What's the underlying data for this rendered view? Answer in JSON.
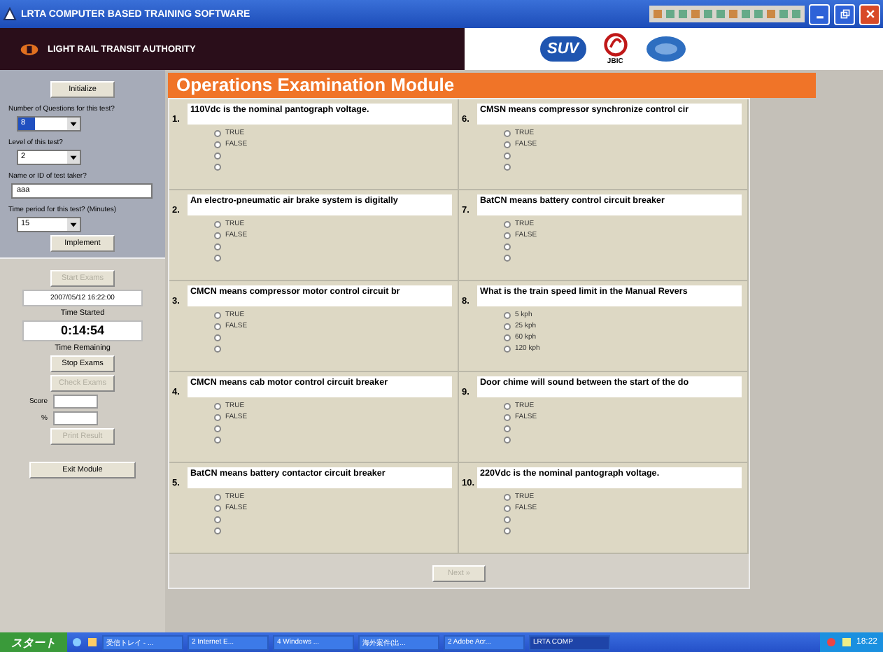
{
  "window": {
    "title": "LRTA COMPUTER BASED TRAINING SOFTWARE"
  },
  "header": {
    "organization": "LIGHT RAIL TRANSIT AUTHORITY",
    "logos": [
      "SUV",
      "JBIC"
    ]
  },
  "sidebar": {
    "initialize": {
      "label": "Initialize",
      "disabled": false
    },
    "fields": [
      {
        "kind": "dropdown",
        "label": "Number of Questions for this test?",
        "value": "8",
        "highlighted": true
      },
      {
        "kind": "dropdown",
        "label": "Level of this test?",
        "value": "2",
        "highlighted": false
      },
      {
        "kind": "text",
        "label": "Name or ID of test taker?",
        "value": "aaa",
        "highlighted": false
      },
      {
        "kind": "dropdown",
        "label": "Time period for this test? (Minutes)",
        "value": "15",
        "highlighted": false
      }
    ],
    "implement": {
      "label": "Implement",
      "disabled": false
    },
    "start": {
      "label": "Start Exams",
      "disabled": true
    },
    "time_started": {
      "value": "2007/05/12 16:22:00",
      "label": "Time Started"
    },
    "time_remaining": {
      "value": "0:14:54",
      "label": "Time Remaining"
    },
    "stop": {
      "label": "Stop Exams",
      "disabled": false
    },
    "check": {
      "label": "Check Exams",
      "disabled": true
    },
    "score": {
      "label": "Score"
    },
    "percent": {
      "label": "%"
    },
    "print": {
      "label": "Print Result",
      "disabled": true
    },
    "exit": {
      "label": "Exit Module",
      "disabled": false
    }
  },
  "module_title": "Operations Examination Module",
  "questions": [
    {
      "number": "1.",
      "text": "110Vdc is the nominal pantograph voltage.",
      "options": [
        {
          "label": "TRUE",
          "selected": false
        },
        {
          "label": "FALSE",
          "selected": false
        },
        {
          "selected": false
        },
        {
          "selected": false
        }
      ]
    },
    {
      "number": "2.",
      "text": "An electro-pneumatic air brake system is digitally",
      "options": [
        {
          "label": "TRUE",
          "selected": false
        },
        {
          "label": "FALSE",
          "selected": false
        },
        {
          "selected": false
        },
        {
          "selected": false
        }
      ]
    },
    {
      "number": "3.",
      "text": "CMCN means compressor motor control circuit br",
      "options": [
        {
          "label": "TRUE",
          "selected": false
        },
        {
          "label": "FALSE",
          "selected": false
        },
        {
          "selected": false
        },
        {
          "selected": false
        }
      ]
    },
    {
      "number": "4.",
      "text": "CMCN means cab motor control circuit breaker",
      "options": [
        {
          "label": "TRUE",
          "selected": false
        },
        {
          "label": "FALSE",
          "selected": false
        },
        {
          "selected": false
        },
        {
          "selected": false
        }
      ]
    },
    {
      "number": "5.",
      "text": "BatCN means battery contactor circuit breaker",
      "options": [
        {
          "label": "TRUE",
          "selected": false
        },
        {
          "label": "FALSE",
          "selected": false
        },
        {
          "selected": false
        },
        {
          "selected": false
        }
      ]
    },
    {
      "number": "6.",
      "text": "CMSN means compressor synchronize control cir",
      "options": [
        {
          "label": "TRUE",
          "selected": false
        },
        {
          "label": "FALSE",
          "selected": false
        },
        {
          "selected": false
        },
        {
          "selected": false
        }
      ]
    },
    {
      "number": "7.",
      "text": "BatCN means battery control circuit breaker",
      "options": [
        {
          "label": "TRUE",
          "selected": false
        },
        {
          "label": "FALSE",
          "selected": false
        },
        {
          "selected": false
        },
        {
          "selected": false
        }
      ]
    },
    {
      "number": "8.",
      "text": "What is the train speed limit in the Manual Revers",
      "options": [
        {
          "label": "5 kph",
          "selected": false
        },
        {
          "label": "25 kph",
          "selected": false
        },
        {
          "label": "60 kph",
          "selected": false
        },
        {
          "label": "120 kph",
          "selected": false
        }
      ]
    },
    {
      "number": "9.",
      "text": "Door chime will sound between the start of the do",
      "options": [
        {
          "label": "TRUE",
          "selected": false
        },
        {
          "label": "FALSE",
          "selected": false
        },
        {
          "selected": false
        },
        {
          "selected": false
        }
      ]
    },
    {
      "number": "10.",
      "text": "220Vdc is the nominal pantograph voltage.",
      "options": [
        {
          "label": "TRUE",
          "selected": false
        },
        {
          "label": "FALSE",
          "selected": false
        },
        {
          "selected": false
        },
        {
          "selected": false
        }
      ]
    }
  ],
  "next": {
    "label": "Next »",
    "disabled": true
  },
  "taskbar": {
    "start": "スタート",
    "tasks": [
      {
        "label": "受信トレイ - ...",
        "active": false
      },
      {
        "label": "2 Internet E...",
        "active": false
      },
      {
        "label": "4 Windows ...",
        "active": false
      },
      {
        "label": "海外案件(出...",
        "active": false
      },
      {
        "label": "2 Adobe Acr...",
        "active": false
      },
      {
        "label": "LRTA COMP",
        "active": true
      }
    ],
    "clock": "18:22"
  }
}
